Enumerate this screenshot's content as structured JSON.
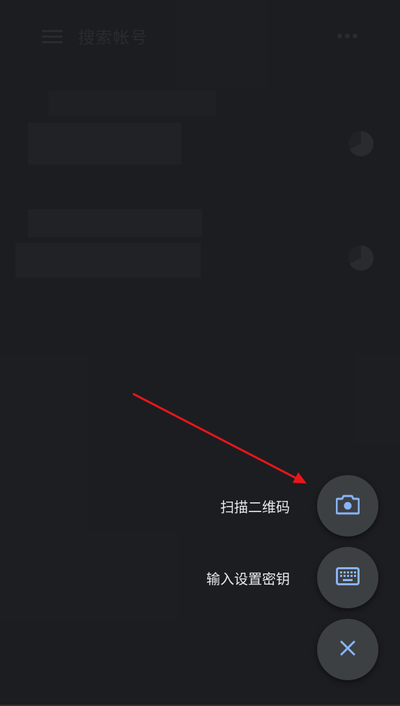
{
  "topbar": {
    "search_label": "搜索帐号",
    "menu_icon": "menu-icon",
    "more_icon": "more-vert-icon"
  },
  "speed_dial": {
    "scan_qr": {
      "label": "扫描二维码",
      "icon": "camera-icon"
    },
    "enter_key": {
      "label": "输入设置密钥",
      "icon": "keyboard-icon"
    },
    "close": {
      "icon": "close-icon"
    }
  },
  "colors": {
    "background": "#202124",
    "fab_background": "#3c4043",
    "fab_icon": "#8ab4f8",
    "label_text": "#e8eaed",
    "annotation_arrow": "#e8161b"
  }
}
